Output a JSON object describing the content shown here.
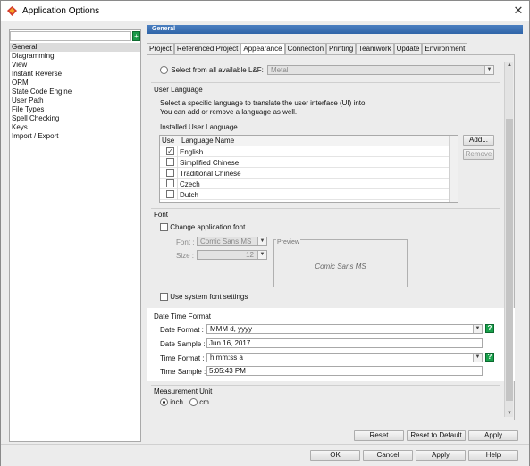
{
  "window": {
    "title": "Application Options",
    "close_glyph": "✕"
  },
  "sidebar": {
    "search_value": "",
    "items": [
      "General",
      "Diagramming",
      "View",
      "Instant Reverse",
      "ORM",
      "State Code Engine",
      "User Path",
      "File Types",
      "Spell Checking",
      "Keys",
      "Import / Export"
    ],
    "selected": "General"
  },
  "section_header": "General",
  "tabs": [
    "Project",
    "Referenced Project",
    "Appearance",
    "Connection",
    "Printing",
    "Teamwork",
    "Update",
    "Environment"
  ],
  "active_tab": "Appearance",
  "lnf": {
    "label": "Select from all available L&F:",
    "value": "Metal"
  },
  "user_language": {
    "title": "User Language",
    "description_line1": "Select a specific language to translate the user interface (UI) into.",
    "description_line2": "You can add or remove a language as well.",
    "installed_label": "Installed User Language",
    "col_use": "Use",
    "col_name": "Language Name",
    "rows": [
      {
        "name": "English",
        "checked": true
      },
      {
        "name": "Simplified Chinese",
        "checked": false
      },
      {
        "name": "Traditional Chinese",
        "checked": false
      },
      {
        "name": "Czech",
        "checked": false
      },
      {
        "name": "Dutch",
        "checked": false
      }
    ],
    "add_label": "Add...",
    "remove_label": "Remove"
  },
  "font": {
    "title": "Font",
    "change_label": "Change application font",
    "font_label": "Font :",
    "font_value": "Comic Sans MS",
    "size_label": "Size :",
    "size_value": "12",
    "preview_label": "Preview",
    "preview_text": "Comic Sans MS",
    "system_label": "Use system font settings"
  },
  "datetime": {
    "title": "Date Time Format",
    "date_format_label": "Date Format :",
    "date_format_value": "MMM d, yyyy",
    "date_sample_label": "Date Sample :",
    "date_sample_value": "Jun 16, 2017",
    "time_format_label": "Time Format :",
    "time_format_value": "h:mm:ss a",
    "time_sample_label": "Time Sample :",
    "time_sample_value": "5:05:43 PM",
    "help_glyph": "?"
  },
  "measurement": {
    "title": "Measurement Unit",
    "inch_label": "inch",
    "cm_label": "cm",
    "selected": "inch"
  },
  "panel_buttons": {
    "reset": "Reset",
    "reset_default": "Reset to Default",
    "apply": "Apply"
  },
  "dialog_buttons": {
    "ok": "OK",
    "cancel": "Cancel",
    "apply": "Apply",
    "help": "Help"
  }
}
